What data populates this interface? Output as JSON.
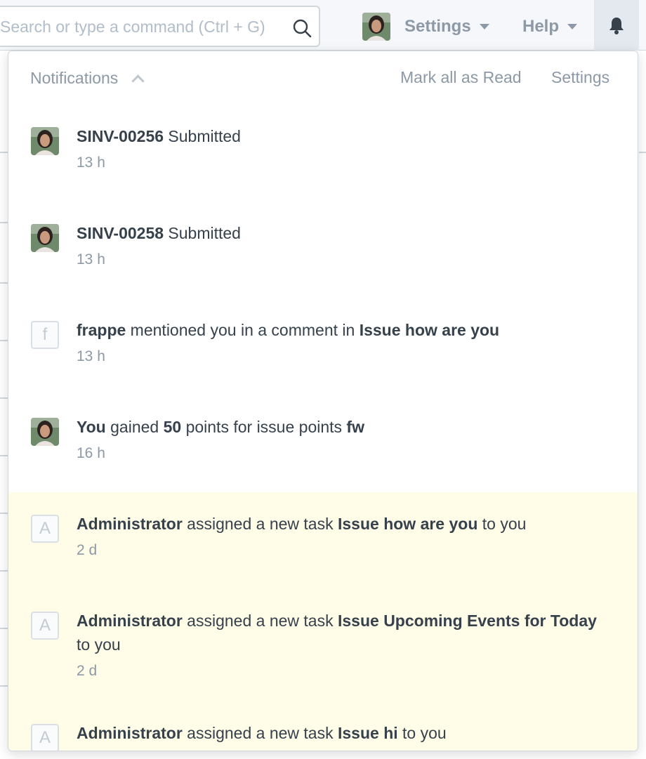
{
  "navbar": {
    "search_placeholder": "Search or type a command (Ctrl + G)",
    "settings_label": "Settings",
    "help_label": "Help",
    "icons": {
      "search": "search-icon",
      "bell": "bell-icon",
      "caret": "caret-down-icon",
      "avatar": "user-avatar"
    }
  },
  "panel": {
    "title": "Notifications",
    "mark_all_read": "Mark all as Read",
    "settings": "Settings",
    "accent_unread_bg": "#fffce8"
  },
  "notifications": [
    {
      "avatar": "photo",
      "actor": "",
      "doc": "SINV-00256",
      "text": " Submitted",
      "time": "13 h"
    },
    {
      "avatar": "photo",
      "actor": "",
      "doc": "SINV-00258",
      "text": " Submitted",
      "time": "13 h"
    },
    {
      "avatar": "f",
      "actor": "frappe",
      "mid": " mentioned you in a comment in ",
      "doc": "Issue how are you",
      "time": "13 h"
    },
    {
      "avatar": "photo",
      "actor": "You",
      "mid": " gained ",
      "points": "50",
      "mid2": " points for issue points ",
      "doc": "fw",
      "time": "16 h"
    },
    {
      "avatar": "A",
      "actor": "Administrator",
      "mid": " assigned a new task ",
      "doc": "Issue how are you",
      "tail": " to you",
      "time": "2 d"
    },
    {
      "avatar": "A",
      "actor": "Administrator",
      "mid": " assigned a new task ",
      "doc": "Issue Upcoming Events for Today",
      "tail": " to you",
      "time": "2 d"
    },
    {
      "avatar": "A",
      "actor": "Administrator",
      "mid": " assigned a new task ",
      "doc": "Issue hi",
      "tail": " to you",
      "time": ""
    }
  ]
}
